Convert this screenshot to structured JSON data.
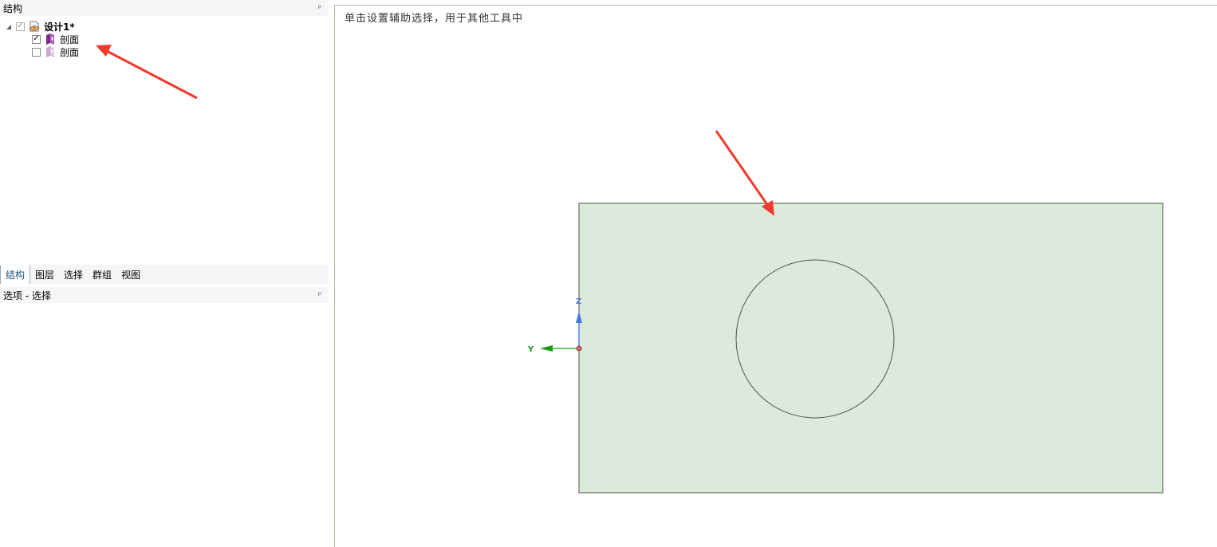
{
  "structure_panel": {
    "title": "结构",
    "tree": [
      {
        "label": "设计1*",
        "checked": true,
        "expanded": true
      },
      {
        "label": "剖面",
        "checked": true
      },
      {
        "label": "剖面",
        "checked": false
      }
    ]
  },
  "tabs": [
    "结构",
    "图层",
    "选择",
    "群组",
    "视图"
  ],
  "options_panel": {
    "title": "选项 - 选择"
  },
  "viewport": {
    "hint": "单击设置辅助选择，用于其他工具中",
    "axes": {
      "z_label": "Z",
      "y_label": "Y"
    },
    "colors": {
      "sketch_fill": "#dbeadb",
      "sketch_stroke": "#4a5a4a",
      "z_axis": "#4a78d8",
      "y_axis": "#1a9a1a",
      "annotation_arrow": "#f03a2e"
    }
  }
}
